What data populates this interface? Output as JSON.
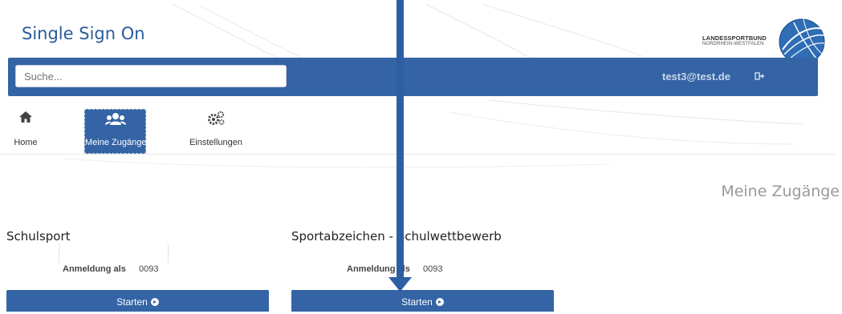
{
  "header": {
    "site_title": "Single Sign On",
    "logo_line1": "LANDESSPORTBUND",
    "logo_line2": "NORDRHEIN-WESTFALEN"
  },
  "topbar": {
    "search_placeholder": "Suche...",
    "user_email": "test3@test.de",
    "logout_icon": "sign-out-icon"
  },
  "nav": {
    "items": [
      {
        "label": "Home",
        "icon": "home-icon",
        "active": false
      },
      {
        "label": "Meine Zugänge",
        "icon": "users-icon",
        "active": true
      },
      {
        "label": "Einstellungen",
        "icon": "gears-icon",
        "active": false
      }
    ]
  },
  "page": {
    "heading": "Meine Zugänge"
  },
  "cards": [
    {
      "title": "Schulsport",
      "login_label": "Anmeldung als",
      "login_value": "0093",
      "button_label": "Starten"
    },
    {
      "title": "Sportabzeichen - Schulwettbewerb",
      "login_label": "Anmeldung als",
      "login_value": "0093",
      "button_label": "Starten"
    }
  ],
  "colors": {
    "primary": "#3464a5",
    "title_blue": "#2a5b9a",
    "annotation_arrow": "#2f5fa3"
  }
}
